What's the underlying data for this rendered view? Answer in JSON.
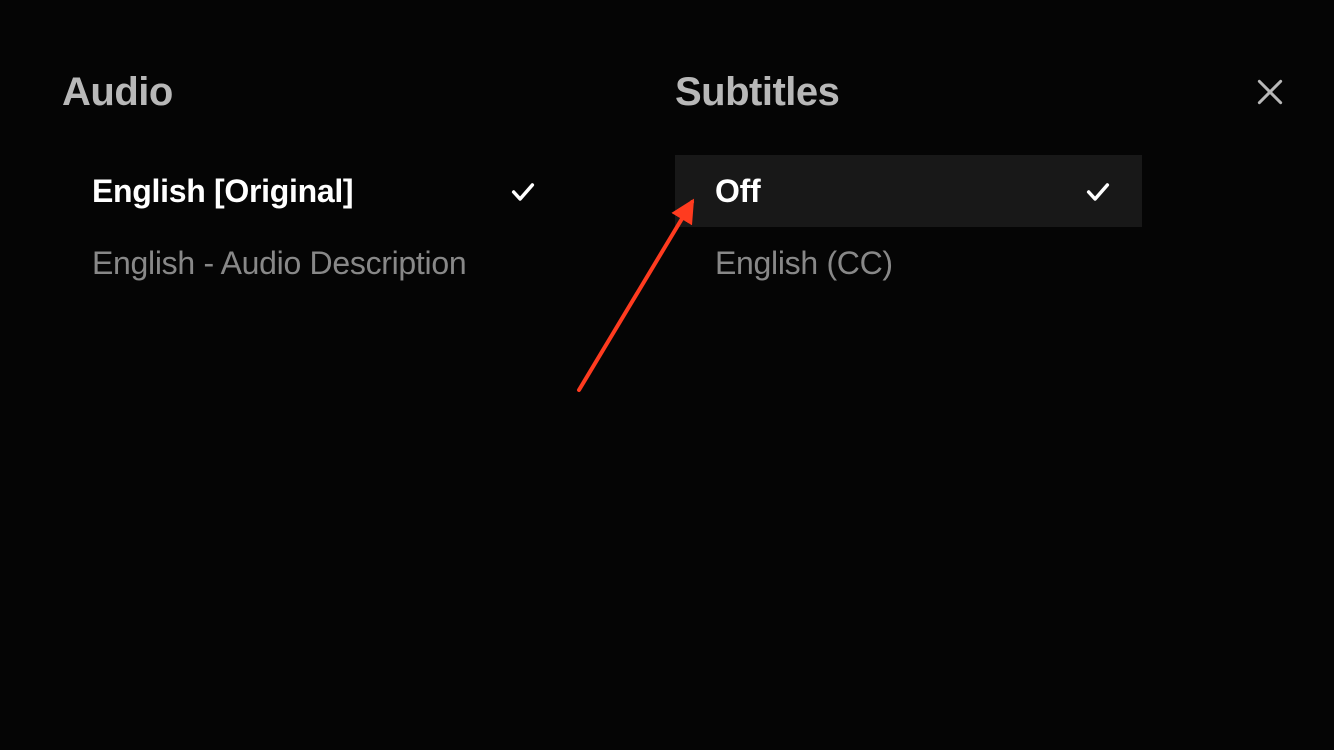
{
  "audio": {
    "title": "Audio",
    "options": [
      {
        "label": "English [Original]",
        "selected": true,
        "highlighted": false
      },
      {
        "label": "English - Audio Description",
        "selected": false,
        "highlighted": false
      }
    ]
  },
  "subtitles": {
    "title": "Subtitles",
    "options": [
      {
        "label": "Off",
        "selected": true,
        "highlighted": true
      },
      {
        "label": "English (CC)",
        "selected": false,
        "highlighted": false
      }
    ]
  },
  "annotation": {
    "color": "#ff3b1f"
  }
}
